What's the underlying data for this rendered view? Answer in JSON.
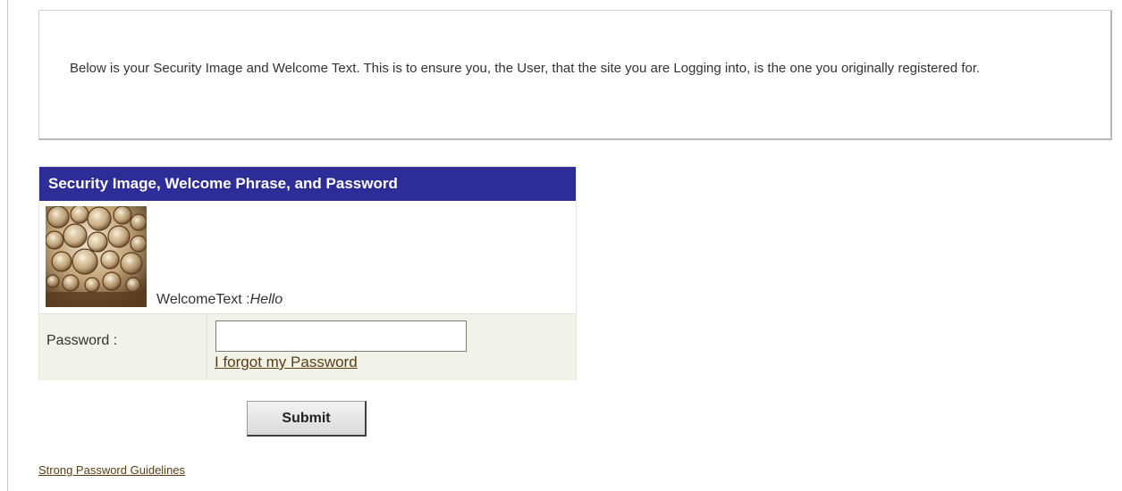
{
  "info": {
    "text": "Below is your Security Image and Welcome Text. This is to ensure you, the User, that the site you are Logging into, is the one you originally registered for."
  },
  "panel": {
    "header": "Security Image, Welcome Phrase, and Password",
    "security_image_icon": "soap-bubbles-image",
    "welcome_label": "WelcomeText :",
    "welcome_value": "Hello",
    "password_label": "Password :",
    "password_value": "",
    "forgot_link": "I forgot my Password"
  },
  "actions": {
    "submit_label": "Submit"
  },
  "footer": {
    "guidelines_link": "Strong Password Guidelines"
  },
  "colors": {
    "header_bg": "#2e2d97",
    "password_row_bg": "#f2f2e8",
    "link": "#5a3e12"
  }
}
